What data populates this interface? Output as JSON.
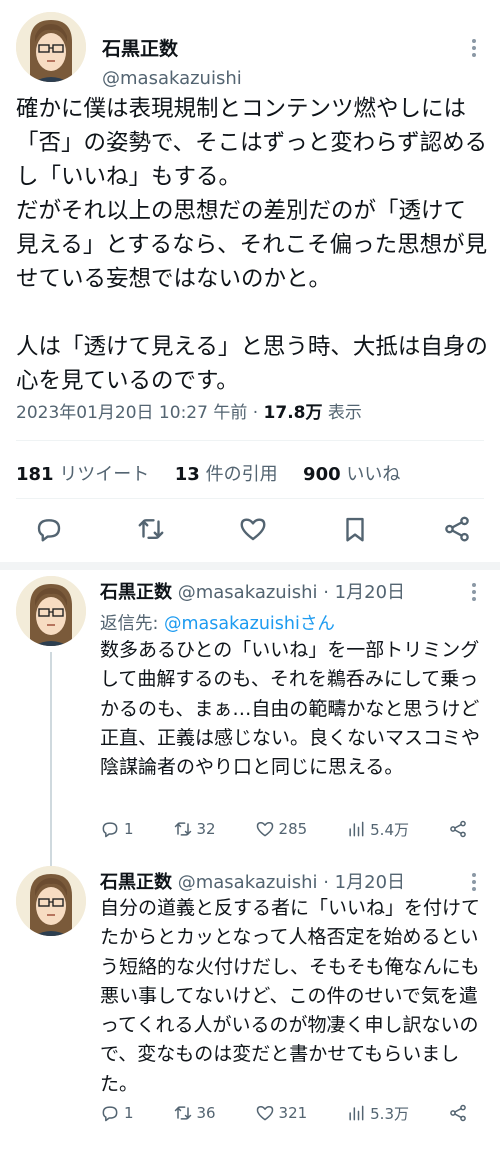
{
  "main": {
    "author_name": "石黒正数",
    "handle": "@masakazuishi",
    "paragraphs": [
      "確かに僕は表現規制とコンテンツ燃やしには「否」の姿勢で、そこはずっと変わらず認めるし「いいね」もする。\nだがそれ以上の思想だの差別だのが「透けて見える」とするなら、それこそ偏った思想が見せている妄想ではないのかと。",
      "人は「透けて見える」と思う時、大抵は自身の心を見ているのです。"
    ],
    "timestamp": "2023年01月20日 10:27 午前",
    "dot": "·",
    "views_count": "17.8万",
    "views_label": "表示",
    "retweets_count": "181",
    "retweets_label": "リツイート",
    "quotes_count": "13",
    "quotes_label": "件の引用",
    "likes_count": "900",
    "likes_label": "いいね",
    "actions": [
      "reply-icon",
      "retweet-icon",
      "heart-icon",
      "bookmark-icon",
      "share-icon"
    ]
  },
  "replies": [
    {
      "author_name": "石黒正数",
      "handle": "@masakazuishi",
      "date": "· 1月20日",
      "reply_to_prefix": "返信先: ",
      "reply_to_handle": "@masakazuishiさん",
      "text": "数多あるひとの「いいね」を一部トリミングして曲解するのも、それを鵜呑みにして乗っかるのも、まぁ…自由の範疇かなと思うけど正直、正義は感じない。良くないマスコミや陰謀論者のやり口と同じに思える。",
      "replies": "1",
      "retweets": "32",
      "likes": "285",
      "views": "5.4万"
    },
    {
      "author_name": "石黒正数",
      "handle": "@masakazuishi",
      "date": "· 1月20日",
      "text": "自分の道義と反する者に「いいね」を付けてたからとカッとなって人格否定を始めるという短絡的な火付けだし、そもそも俺なんにも悪い事してないけど、この件のせいで気を遣ってくれる人がいるのが物凄く申し訳ないので、変なものは変だと書かせてもらいました。",
      "replies": "1",
      "retweets": "36",
      "likes": "321",
      "views": "5.3万"
    }
  ],
  "colors": {
    "text": "#0f1419",
    "secondary": "#536471",
    "link": "#1d9bf0",
    "divider": "#f2f4f5"
  }
}
